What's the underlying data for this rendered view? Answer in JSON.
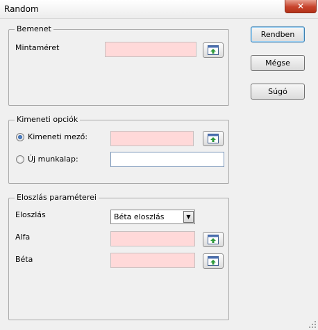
{
  "window": {
    "title": "Random",
    "close_glyph": "✕"
  },
  "groups": {
    "input": {
      "label": "Bemenet",
      "sample_size_label": "Mintaméret",
      "sample_size_value": ""
    },
    "output": {
      "label": "Kimeneti opciók",
      "output_field_label": "Kimeneti mező:",
      "output_field_value": "",
      "new_sheet_label": "Új munkalap:",
      "new_sheet_value": "",
      "selected_option": "output_field"
    },
    "distribution": {
      "label": "Eloszlás paraméterei",
      "distribution_label": "Eloszlás",
      "distribution_value": "Béta eloszlás",
      "alpha_label": "Alfa",
      "alpha_value": "",
      "beta_label": "Béta",
      "beta_value": ""
    }
  },
  "buttons": {
    "ok": "Rendben",
    "cancel": "Mégse",
    "help": "Súgó"
  },
  "icons": {
    "range_picker": "range-select-icon",
    "dropdown": "dropdown-arrow-icon",
    "close": "close-icon",
    "resize": "resize-grip-icon"
  },
  "colors": {
    "invalid_field": "#ffd9d9",
    "default_button_border": "#3c7fb1",
    "close_button": "#c7432c"
  }
}
